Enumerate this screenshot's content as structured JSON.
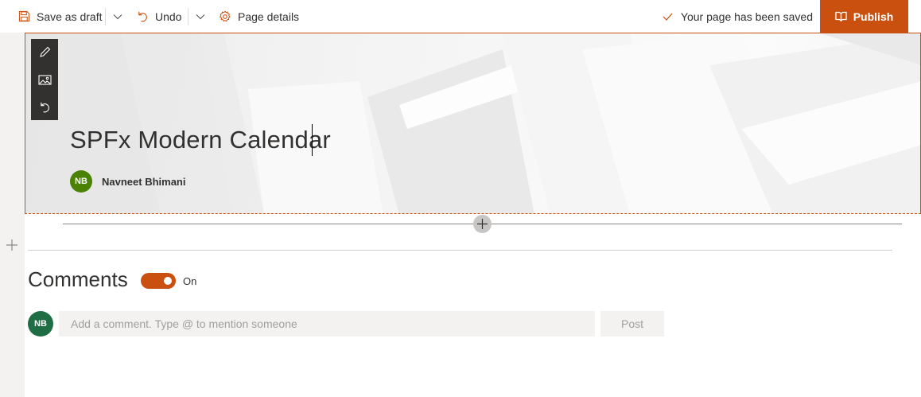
{
  "colors": {
    "accent": "#ca5010",
    "author_avatar_bg": "#498205",
    "commenter_avatar_bg": "#1f6e43",
    "toolbar_bg": "#323130"
  },
  "command_bar": {
    "save_draft_label": "Save as draft",
    "undo_label": "Undo",
    "page_details_label": "Page details",
    "status_text": "Your page has been saved",
    "publish_label": "Publish"
  },
  "hero": {
    "toolbar_icons": [
      "edit-icon",
      "change-image-icon",
      "reset-icon"
    ],
    "title": "SPFx Modern Calendar",
    "author": {
      "initials": "NB",
      "name": "Navneet Bhimani"
    }
  },
  "comments": {
    "title": "Comments",
    "toggle_state": "On",
    "toggle_on": true,
    "avatar_initials": "NB",
    "input_placeholder": "Add a comment. Type @ to mention someone",
    "post_label": "Post"
  }
}
